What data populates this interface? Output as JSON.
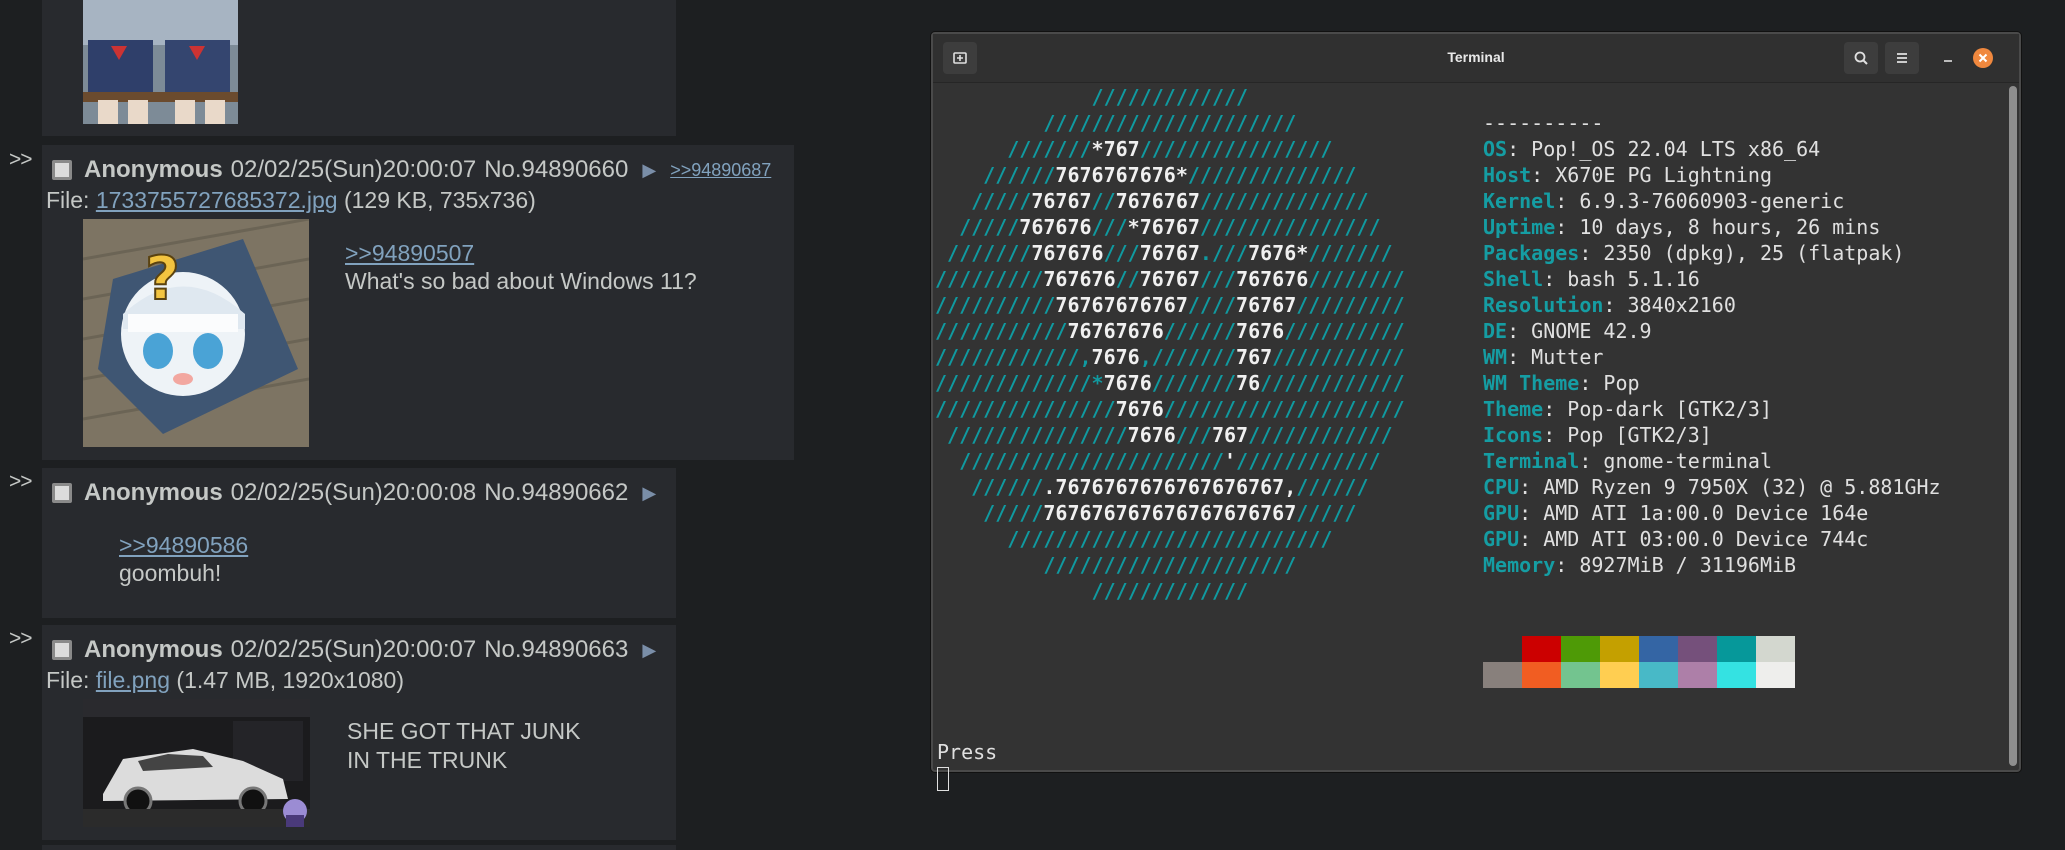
{
  "thread": {
    "posts": [
      {
        "arrows": ">>",
        "name": "Anonymous",
        "datetime": "02/02/25(Sun)20:00:07",
        "number": "No.94890660",
        "backlink": ">>94890687",
        "file_label": "File:",
        "file_name": "1733755727685372.jpg",
        "file_info": "(129 KB, 735x736)",
        "quote": ">>94890507",
        "message": "What's so bad about Windows 11?"
      },
      {
        "arrows": ">>",
        "name": "Anonymous",
        "datetime": "02/02/25(Sun)20:00:08",
        "number": "No.94890662",
        "quote": ">>94890586",
        "message": "goombuh!"
      },
      {
        "arrows": ">>",
        "name": "Anonymous",
        "datetime": "02/02/25(Sun)20:00:07",
        "number": "No.94890663",
        "file_label": "File:",
        "file_name": "file.png",
        "file_info": "(1.47 MB, 1920x1080)",
        "message_lines": [
          "SHE GOT THAT JUNK",
          "IN THE TRUNK"
        ]
      }
    ]
  },
  "terminal": {
    "title": "Terminal",
    "separator": "----------",
    "info": [
      {
        "key": "OS",
        "value": ": Pop!_OS 22.04 LTS x86_64"
      },
      {
        "key": "Host",
        "value": ": X670E PG Lightning"
      },
      {
        "key": "Kernel",
        "value": ": 6.9.3-76060903-generic"
      },
      {
        "key": "Uptime",
        "value": ": 10 days, 8 hours, 26 mins"
      },
      {
        "key": "Packages",
        "value": ": 2350 (dpkg), 25 (flatpak)"
      },
      {
        "key": "Shell",
        "value": ": bash 5.1.16"
      },
      {
        "key": "Resolution",
        "value": ": 3840x2160"
      },
      {
        "key": "DE",
        "value": ": GNOME 42.9"
      },
      {
        "key": "WM",
        "value": ": Mutter"
      },
      {
        "key": "WM Theme",
        "value": ": Pop"
      },
      {
        "key": "Theme",
        "value": ": Pop-dark [GTK2/3]"
      },
      {
        "key": "Icons",
        "value": ": Pop [GTK2/3]"
      },
      {
        "key": "Terminal",
        "value": ": gnome-terminal"
      },
      {
        "key": "CPU",
        "value": ": AMD Ryzen 9 7950X (32) @ 5.881GHz"
      },
      {
        "key": "GPU",
        "value": ": AMD ATI 1a:00.0 Device 164e"
      },
      {
        "key": "GPU",
        "value": ": AMD ATI 03:00.0 Device 744c"
      },
      {
        "key": "Memory",
        "value": ": 8927MiB / 31196MiB"
      }
    ],
    "palette_row1": [
      "#333333",
      "#cc0000",
      "#4e9a06",
      "#c4a000",
      "#3465a4",
      "#75507b",
      "#06989a",
      "#d3d7cf"
    ],
    "palette_row2": [
      "#88807c",
      "#f15d22",
      "#73c48f",
      "#ffce51",
      "#48b9c7",
      "#ad7fa8",
      "#34e2e2",
      "#eeeeec"
    ],
    "prompt": "Press",
    "ascii_color": "#109aa0",
    "key_color": "#159da3"
  }
}
